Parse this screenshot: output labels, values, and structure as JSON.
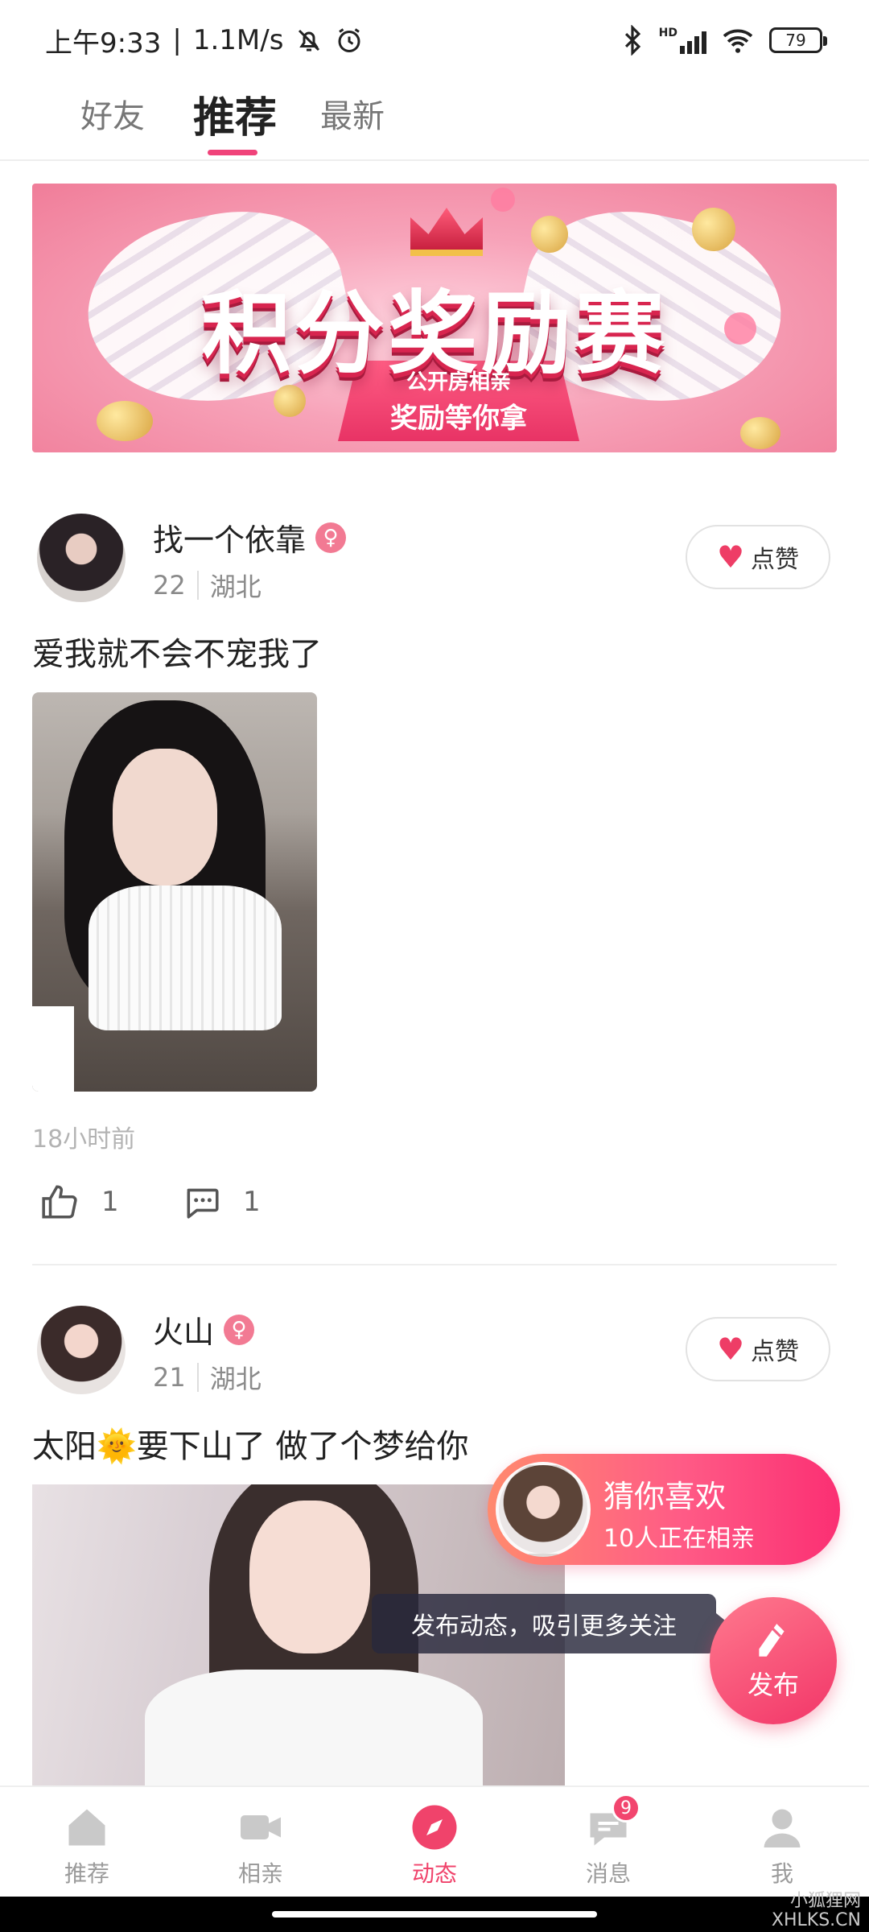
{
  "status_bar": {
    "time": "上午9:33",
    "speed": "1.1M/s",
    "battery": "79",
    "network": "HD"
  },
  "tabs": [
    "好友",
    "推荐",
    "最新"
  ],
  "banner": {
    "title": "积分奖励赛",
    "sub1": "公开房相亲",
    "sub2": "奖励等你拿"
  },
  "posts": [
    {
      "name": "找一个依靠",
      "gender": "♀",
      "age": "22",
      "location": "湖北",
      "like_label": "点赞",
      "text": "爱我就不会不宠我了",
      "time": "18小时前",
      "likes": "1",
      "comments": "1"
    },
    {
      "name": "火山",
      "gender": "♀",
      "age": "21",
      "location": "湖北",
      "like_label": "点赞",
      "text": "太阳🌞要下山了  做了个梦给你"
    }
  ],
  "guess": {
    "title": "猜你喜欢",
    "subtitle": "10人正在相亲"
  },
  "tooltip": "发布动态，吸引更多关注",
  "publish_label": "发布",
  "nav": [
    {
      "label": "推荐"
    },
    {
      "label": "相亲"
    },
    {
      "label": "动态"
    },
    {
      "label": "消息",
      "badge": "9"
    },
    {
      "label": "我"
    }
  ],
  "watermark": [
    "小狐狸网",
    "XHLKS.CN"
  ],
  "colors": {
    "accent": "#f0437a",
    "like_heart": "#ee3d66"
  }
}
